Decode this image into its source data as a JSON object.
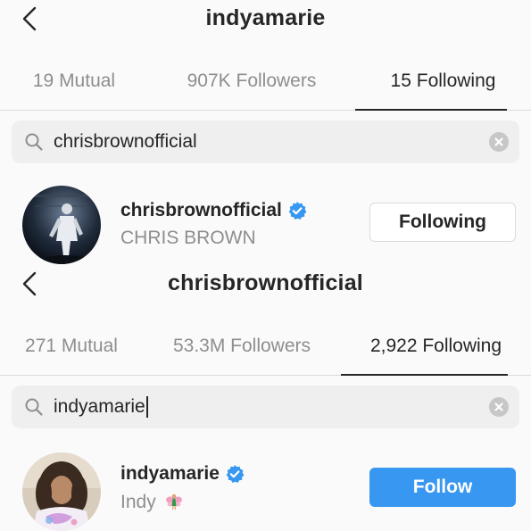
{
  "screens": [
    {
      "title": "indyamarie",
      "tabs": [
        {
          "label": "19 Mutual",
          "active": false
        },
        {
          "label": "907K Followers",
          "active": false
        },
        {
          "label": "15 Following",
          "active": true
        }
      ],
      "search": {
        "value": "chrisbrownofficial",
        "focused": false
      },
      "result": {
        "username": "chrisbrownofficial",
        "full_name": "CHRIS BROWN",
        "verified": true,
        "button_label": "Following",
        "button_style": "following"
      }
    },
    {
      "title": "chrisbrownofficial",
      "tabs": [
        {
          "label": "271 Mutual",
          "active": false
        },
        {
          "label": "53.3M Followers",
          "active": false
        },
        {
          "label": "2,922 Following",
          "active": true
        }
      ],
      "search": {
        "value": "indyamarie",
        "focused": true
      },
      "result": {
        "username": "indyamarie",
        "full_name": "Indy",
        "full_name_emoji": "fairy-emoji",
        "verified": true,
        "button_label": "Follow",
        "button_style": "follow"
      }
    }
  ],
  "icons": {
    "back": "chevron-left-icon",
    "search": "search-icon",
    "clear": "clear-search-icon",
    "verified": "verified-badge-icon"
  },
  "colors": {
    "accent_blue": "#3897f0",
    "verified_blue": "#3897f0",
    "muted_text": "#8e8e8e",
    "primary_text": "#262626",
    "search_bg": "#efefef"
  }
}
